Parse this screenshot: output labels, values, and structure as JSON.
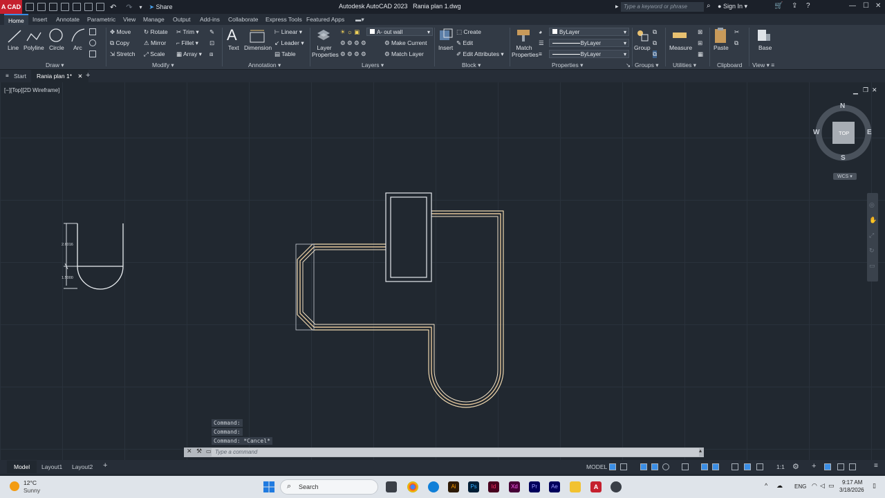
{
  "app": {
    "logo": "A CAD",
    "share_label": "Share",
    "title": "Autodesk AutoCAD 2023",
    "document": "Rania plan 1.dwg",
    "search_placeholder": "Type a keyword or phrase",
    "signin": "Sign In"
  },
  "tabs": [
    "Home",
    "Insert",
    "Annotate",
    "Parametric",
    "View",
    "Manage",
    "Output",
    "Add-ins",
    "Collaborate",
    "Express Tools",
    "Featured Apps"
  ],
  "ribbon": {
    "draw": {
      "line": "Line",
      "polyline": "Polyline",
      "circle": "Circle",
      "arc": "Arc",
      "label": "Draw"
    },
    "modify": {
      "move": "Move",
      "rotate": "Rotate",
      "trim": "Trim",
      "copy": "Copy",
      "mirror": "Mirror",
      "fillet": "Fillet",
      "stretch": "Stretch",
      "scale": "Scale",
      "array": "Array",
      "label": "Modify"
    },
    "annotation": {
      "text": "Text",
      "dimension": "Dimension",
      "linear": "Linear",
      "leader": "Leader",
      "table": "Table",
      "label": "Annotation"
    },
    "layers": {
      "properties": "Layer Properties",
      "current_layer": "A- out wall",
      "make_current": "Make Current",
      "match_layer": "Match Layer",
      "label": "Layers"
    },
    "block": {
      "insert": "Insert",
      "create": "Create",
      "edit": "Edit",
      "edit_attributes": "Edit Attributes",
      "label": "Block"
    },
    "properties": {
      "match": "Match Properties",
      "color": "ByLayer",
      "linetype": "ByLayer",
      "lineweight": "ByLayer",
      "label": "Properties"
    },
    "groups": {
      "group": "Group",
      "label": "Groups"
    },
    "utilities": {
      "measure": "Measure",
      "label": "Utilities"
    },
    "clipboard": {
      "paste": "Paste",
      "label": "Clipboard"
    },
    "view": {
      "base": "Base",
      "label": "View"
    }
  },
  "doc_tabs": {
    "start": "Start",
    "active": "Rania plan 1*"
  },
  "viewport": {
    "label": "[−][Top][2D Wireframe]",
    "compass": {
      "n": "N",
      "s": "S",
      "e": "E",
      "w": "W",
      "top": "TOP",
      "wcs": "WCS"
    },
    "dims": {
      "upper": "2.6016",
      "lower": "1.5000"
    }
  },
  "command": {
    "history": [
      "Command:",
      "Command:",
      "Command: *Cancel*"
    ],
    "placeholder": "Type a command"
  },
  "status": {
    "model_tab": "Model",
    "layout1": "Layout1",
    "layout2": "Layout2",
    "model": "MODEL",
    "scale": "1:1"
  },
  "taskbar": {
    "temp": "12°C",
    "weather": "Sunny",
    "search": "Search",
    "lang": "ENG",
    "time": "9:17 AM",
    "date": "3/18/2026"
  },
  "colors": {
    "wall": "#e8c89a",
    "accent": "#3a8ee6",
    "autocad_red": "#c5202e"
  }
}
